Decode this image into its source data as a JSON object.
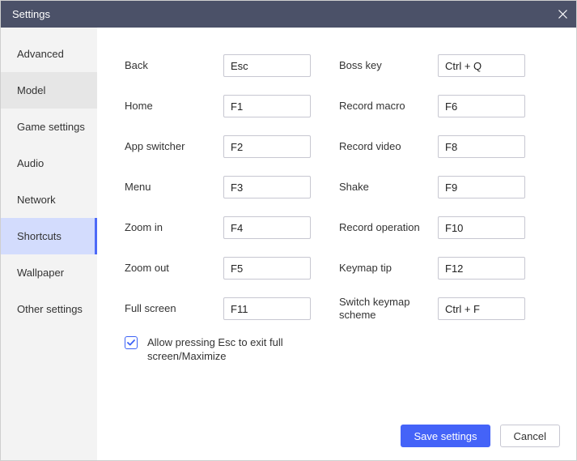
{
  "window": {
    "title": "Settings"
  },
  "sidebar": {
    "items": [
      {
        "label": "Advanced",
        "state": ""
      },
      {
        "label": "Model",
        "state": "hover"
      },
      {
        "label": "Game settings",
        "state": ""
      },
      {
        "label": "Audio",
        "state": ""
      },
      {
        "label": "Network",
        "state": ""
      },
      {
        "label": "Shortcuts",
        "state": "active"
      },
      {
        "label": "Wallpaper",
        "state": ""
      },
      {
        "label": "Other settings",
        "state": ""
      }
    ]
  },
  "shortcuts": {
    "left": [
      {
        "label": "Back",
        "value": "Esc"
      },
      {
        "label": "Home",
        "value": "F1"
      },
      {
        "label": "App switcher",
        "value": "F2"
      },
      {
        "label": "Menu",
        "value": "F3"
      },
      {
        "label": "Zoom in",
        "value": "F4"
      },
      {
        "label": "Zoom out",
        "value": "F5"
      },
      {
        "label": "Full screen",
        "value": "F11"
      }
    ],
    "right": [
      {
        "label": "Boss key",
        "value": "Ctrl + Q"
      },
      {
        "label": "Record macro",
        "value": "F6"
      },
      {
        "label": "Record video",
        "value": "F8"
      },
      {
        "label": "Shake",
        "value": "F9"
      },
      {
        "label": "Record operation",
        "value": "F10"
      },
      {
        "label": "Keymap tip",
        "value": "F12"
      },
      {
        "label": "Switch keymap scheme",
        "value": "Ctrl + F"
      }
    ],
    "allow_esc_label": "Allow pressing Esc to exit full screen/Maximize",
    "allow_esc_checked": true
  },
  "buttons": {
    "save": "Save settings",
    "cancel": "Cancel"
  }
}
